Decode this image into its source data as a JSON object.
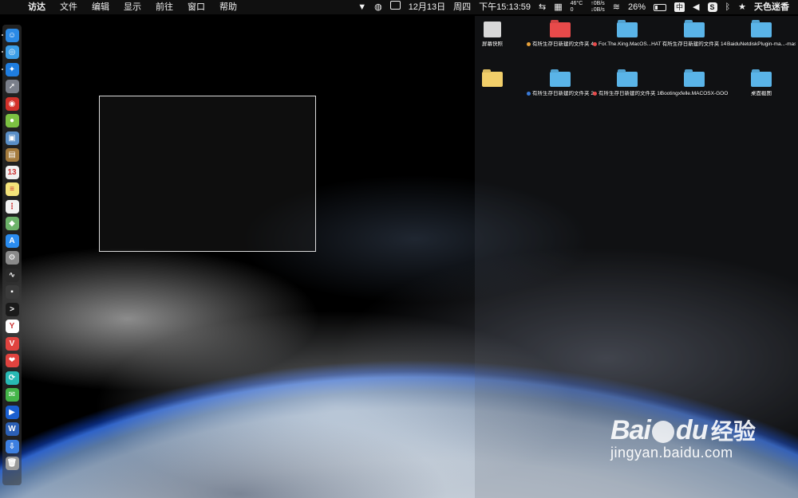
{
  "menubar": {
    "app_name": "访达",
    "items": [
      "文件",
      "编辑",
      "显示",
      "前往",
      "窗口",
      "帮助"
    ],
    "date": "12月13日",
    "weekday": "周四",
    "time": "下午15:13:59",
    "temperature": "46°C",
    "temperature_sub": "0",
    "net_up": "↑0B/s",
    "net_down": "↓0B/s",
    "battery_percent": "26%",
    "battery_level": 0.26,
    "ime_label": "中",
    "s_label": "S",
    "user_name": "天色迷香"
  },
  "dock": {
    "apps": [
      {
        "name": "finder",
        "color": "#2b8ae6",
        "glyph": "☺"
      },
      {
        "name": "safari-like",
        "color": "#3b9ee8",
        "glyph": "◎"
      },
      {
        "name": "safari",
        "color": "#1f7de0",
        "glyph": "✦"
      },
      {
        "name": "launchpad",
        "color": "#7a7f8a",
        "glyph": "➚"
      },
      {
        "name": "app-red",
        "color": "#d3312a",
        "glyph": "◉"
      },
      {
        "name": "android",
        "color": "#7cc142",
        "glyph": "●"
      },
      {
        "name": "preview",
        "color": "#5a8fc8",
        "glyph": "▣"
      },
      {
        "name": "notes-brown",
        "color": "#a57b3d",
        "glyph": "▤"
      },
      {
        "name": "calendar",
        "color": "#f2f2f2",
        "glyph": "13"
      },
      {
        "name": "notes",
        "color": "#f4e37a",
        "glyph": "≡"
      },
      {
        "name": "reminders",
        "color": "#f2f2f2",
        "glyph": "⋮"
      },
      {
        "name": "maps",
        "color": "#6db36a",
        "glyph": "◆"
      },
      {
        "name": "app-store",
        "color": "#2a8cf0",
        "glyph": "A"
      },
      {
        "name": "system-preferences",
        "color": "#8a8a8a",
        "glyph": "⚙"
      },
      {
        "name": "activity-monitor",
        "color": "#2a2a2a",
        "glyph": "∿"
      },
      {
        "name": "console",
        "color": "#3a3a3a",
        "glyph": "▪"
      },
      {
        "name": "terminal",
        "color": "#1a1a1a",
        "glyph": ">"
      },
      {
        "name": "yandex",
        "color": "#ffffff",
        "glyph": "Y"
      },
      {
        "name": "vivaldi",
        "color": "#e0433f",
        "glyph": "V"
      },
      {
        "name": "weibo",
        "color": "#e0433f",
        "glyph": "❤"
      },
      {
        "name": "app-teal",
        "color": "#28b9b4",
        "glyph": "⟳"
      },
      {
        "name": "wechat",
        "color": "#44b549",
        "glyph": "✉"
      },
      {
        "name": "qq-player",
        "color": "#1a5fd0",
        "glyph": "▶"
      },
      {
        "name": "word",
        "color": "#2b5fb4",
        "glyph": "W"
      },
      {
        "name": "downloads",
        "color": "#3d7fe0",
        "glyph": "⇩"
      },
      {
        "name": "trash",
        "color": "#9a9a9a",
        "glyph": "🗑"
      }
    ]
  },
  "desktop": {
    "items": [
      {
        "label": "屏幕快照",
        "kind": "thumb",
        "color": "#d8d8d8",
        "tag": ""
      },
      {
        "label": "有所生存日新建的文件夹 4",
        "kind": "folder",
        "color": "#e84a4a",
        "tag": "#e8a13a"
      },
      {
        "label": "For.The.King.MacOS...HATED",
        "kind": "folder",
        "color": "#5ab4e8",
        "tag": "#e84a4a"
      },
      {
        "label": "有所生存日新建的文件夹 14",
        "kind": "folder",
        "color": "#5ab4e8",
        "tag": ""
      },
      {
        "label": "BaiduNetdiskPlugin-ma...-master",
        "kind": "folder",
        "color": "#5ab4e8",
        "tag": ""
      },
      {
        "label": "",
        "kind": "folder",
        "color": "#f2cf6a",
        "tag": ""
      },
      {
        "label": "有所生存日新建的文件夹 2",
        "kind": "folder",
        "color": "#5ab4e8",
        "tag": "#3a7ad8"
      },
      {
        "label": "有所生存日新建的文件夹 10",
        "kind": "folder",
        "color": "#5ab4e8",
        "tag": "#e84a4a"
      },
      {
        "label": "Bootingxfelle.MACOSX-GOO",
        "kind": "folder",
        "color": "#5ab4e8",
        "tag": ""
      },
      {
        "label": "桌面截图",
        "kind": "folder",
        "color": "#5ab4e8",
        "tag": ""
      }
    ]
  },
  "watermark": {
    "logo": "Bai",
    "logo_tail": "du",
    "chinese": "经验",
    "url": "jingyan.baidu.com"
  }
}
